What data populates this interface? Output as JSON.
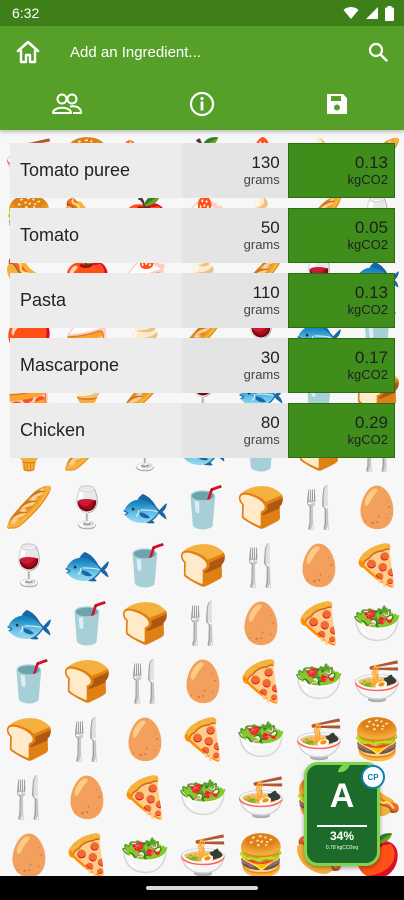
{
  "status_bar": {
    "time": "6:32"
  },
  "app_bar": {
    "title": "Add an Ingredient..."
  },
  "tabs": [
    {
      "icon": "people-icon"
    },
    {
      "icon": "info-icon"
    },
    {
      "icon": "save-icon"
    }
  ],
  "ingredients": [
    {
      "name": "Tomato puree",
      "amount": "130",
      "amount_unit": "grams",
      "co2": "0.13",
      "co2_unit": "kgCO2"
    },
    {
      "name": "Tomato",
      "amount": "50",
      "amount_unit": "grams",
      "co2": "0.05",
      "co2_unit": "kgCO2"
    },
    {
      "name": "Pasta",
      "amount": "110",
      "amount_unit": "grams",
      "co2": "0.13",
      "co2_unit": "kgCO2"
    },
    {
      "name": "Mascarpone",
      "amount": "30",
      "amount_unit": "grams",
      "co2": "0.17",
      "co2_unit": "kgCO2"
    },
    {
      "name": "Chicken",
      "amount": "80",
      "amount_unit": "grams",
      "co2": "0.29",
      "co2_unit": "kgCO2"
    }
  ],
  "rating_badge": {
    "grade": "A",
    "percent": "34%",
    "total": "0.78 kgCO2eq",
    "logo_text": "CP"
  },
  "colors": {
    "app_bar": "#56a02a",
    "status_bar": "#3f7f1a",
    "co2_cell": "#3f8e1c",
    "badge": "#1c6b2a"
  }
}
